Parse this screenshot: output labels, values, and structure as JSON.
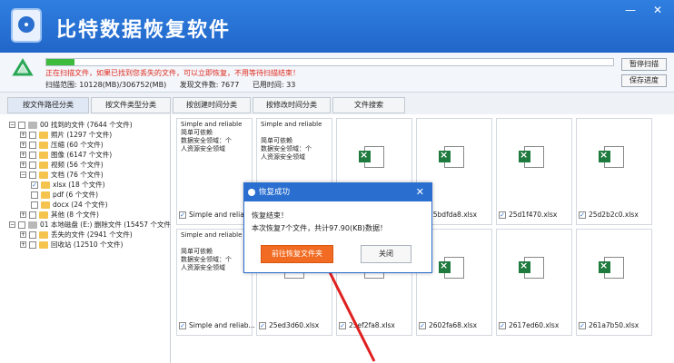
{
  "window": {
    "title": "比特数据恢复软件",
    "minimize": "—",
    "close": "✕"
  },
  "scan": {
    "status_text": "正在扫描文件，如果已找到您丢失的文件，可以立即恢复，不用等待扫描结束！",
    "range": "扫描范围: 10128(MB)/306752(MB)",
    "found": "发现文件数: 7677",
    "elapsed": "已用时间: 33",
    "progress": 0.05,
    "pause_label": "暂停扫描",
    "save_label": "保存进度"
  },
  "tabs": [
    "按文件路径分类",
    "按文件类型分类",
    "按创建时间分类",
    "按修改时间分类",
    "文件搜索"
  ],
  "tree": [
    {
      "label": "00 找到的文件 (7644 个文件)",
      "indent": 0,
      "toggle": "−",
      "checkbox": "",
      "folder": "gray"
    },
    {
      "label": "照片",
      "count": "(1297 个文件)",
      "indent": 1,
      "toggle": "+",
      "checkbox": "",
      "folder": "yellow"
    },
    {
      "label": "压缩",
      "count": "(60 个文件)",
      "indent": 1,
      "toggle": "+",
      "checkbox": "",
      "folder": "yellow"
    },
    {
      "label": "图像",
      "count": "(6147 个文件)",
      "indent": 1,
      "toggle": "+",
      "checkbox": "",
      "folder": "yellow"
    },
    {
      "label": "视频",
      "count": "(56 个文件)",
      "indent": 1,
      "toggle": "+",
      "checkbox": "",
      "folder": "yellow"
    },
    {
      "label": "文档",
      "count": "(76 个文件)",
      "indent": 1,
      "toggle": "−",
      "checkbox": "",
      "folder": "yellow"
    },
    {
      "label": "xlsx",
      "count": "(18 个文件)",
      "indent": 2,
      "toggle": "",
      "checkbox": "✓",
      "folder": "yellow"
    },
    {
      "label": "pdf",
      "count": "(6 个文件)",
      "indent": 2,
      "toggle": "",
      "checkbox": "",
      "folder": "yellow"
    },
    {
      "label": "docx",
      "count": "(24 个文件)",
      "indent": 2,
      "toggle": "",
      "checkbox": "",
      "folder": "yellow"
    },
    {
      "label": "其他",
      "count": "(8 个文件)",
      "indent": 1,
      "toggle": "+",
      "checkbox": "",
      "folder": "yellow"
    },
    {
      "label": "01 本地磁盘 (E:) 删除文件 (15457 个文件",
      "indent": 0,
      "toggle": "−",
      "checkbox": "",
      "folder": "gray"
    },
    {
      "label": "丢失的文件",
      "count": "(2941 个文件)",
      "indent": 1,
      "toggle": "+",
      "checkbox": "",
      "folder": "yellow"
    },
    {
      "label": "回收站",
      "count": "(12510 个文件)",
      "indent": 1,
      "toggle": "+",
      "checkbox": "",
      "folder": "yellow"
    }
  ],
  "files": [
    {
      "name": "Simple and reliable",
      "kind": "doc",
      "doc_lines": [
        "Simple and reliable",
        "简单可依赖",
        "数据安全领域：个",
        "人资源安全领域"
      ]
    },
    {
      "name": "",
      "kind": "doc",
      "doc_lines": [
        "Simple and reliable",
        "",
        "简单可依赖",
        "数据安全领域：个",
        "人资源安全领域"
      ]
    },
    {
      "name": "",
      "kind": "xlsx"
    },
    {
      "name": "25bdfda8.xlsx",
      "kind": "xlsx"
    },
    {
      "name": "25d1f470.xlsx",
      "kind": "xlsx"
    },
    {
      "name": "25d2b2c0.xlsx",
      "kind": "xlsx"
    },
    {
      "name": "Simple and reliab...",
      "kind": "doc",
      "doc_lines": [
        "Simple and reliable",
        "",
        "简单可依赖",
        "数据安全领域：个",
        "人资源安全领域"
      ]
    },
    {
      "name": "25ed3d60.xlsx",
      "kind": "xlsx"
    },
    {
      "name": "25ef2fa8.xlsx",
      "kind": "xlsx"
    },
    {
      "name": "2602fa68.xlsx",
      "kind": "xlsx"
    },
    {
      "name": "2617ed60.xlsx",
      "kind": "xlsx"
    },
    {
      "name": "261a7b50.xlsx",
      "kind": "xlsx"
    }
  ],
  "dialog": {
    "title": "恢复成功",
    "line1": "恢复结束！",
    "line2": "本次恢复7个文件，共计97.90(KB)数据！",
    "open_label": "前往恢复文件夹",
    "close_label": "关闭"
  }
}
